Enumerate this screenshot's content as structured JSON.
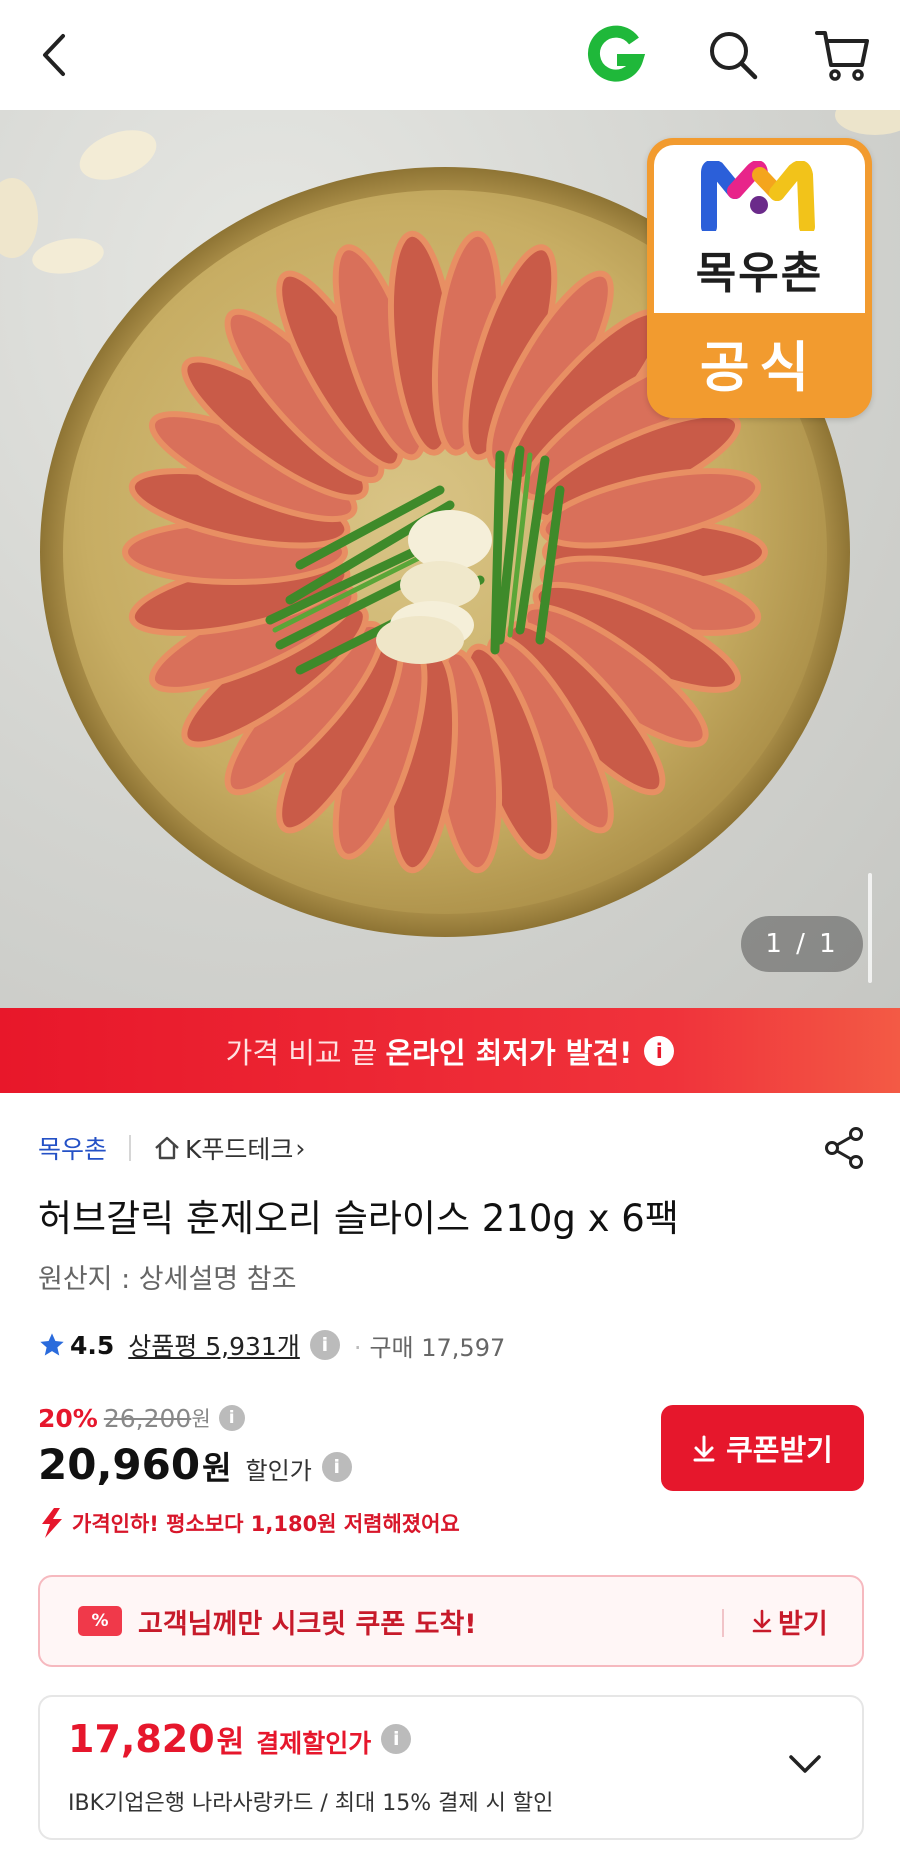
{
  "header": {
    "back_icon": "back-arrow-icon",
    "brand_icon": "gmarket-g-icon",
    "search_icon": "search-icon",
    "cart_icon": "cart-icon"
  },
  "hero": {
    "badge_brand": "목우촌",
    "badge_official": "공식",
    "pager": "1 / 1"
  },
  "promo": {
    "text_light": "가격 비교 끝",
    "text_strong": "온라인 최저가 발견!",
    "info": "i"
  },
  "product": {
    "seller": "목우촌",
    "store": "K푸드테크",
    "store_arrow": "›",
    "title": "허브갈릭 훈제오리 슬라이스 210g x 6팩",
    "origin": "원산지 : 상세설명 참조",
    "rating": "4.5",
    "review": "상품평 5,931개",
    "purchase": "구매 17,597",
    "discount_pct": "20%",
    "original_price": "26,200",
    "original_unit": "원",
    "price": "20,960",
    "price_unit": "원",
    "price_label": "할인가",
    "coupon_button": "쿠폰받기",
    "price_drop": "가격인하! 평소보다 1,180원 저렴해졌어요"
  },
  "secret_coupon": {
    "ticket": "%",
    "message": "고객님께만 시크릿 쿠폰 도착!",
    "get": "받기"
  },
  "payment": {
    "price": "17,820",
    "unit": "원",
    "label": "결제할인가",
    "description": "IBK기업은행 나라사랑카드 / 최대 15% 결제 시 할인"
  },
  "colors": {
    "accent_red": "#e6172c",
    "seller_blue": "#2451c6",
    "badge_orange": "#f29b2f",
    "g_green": "#1fb83a"
  }
}
